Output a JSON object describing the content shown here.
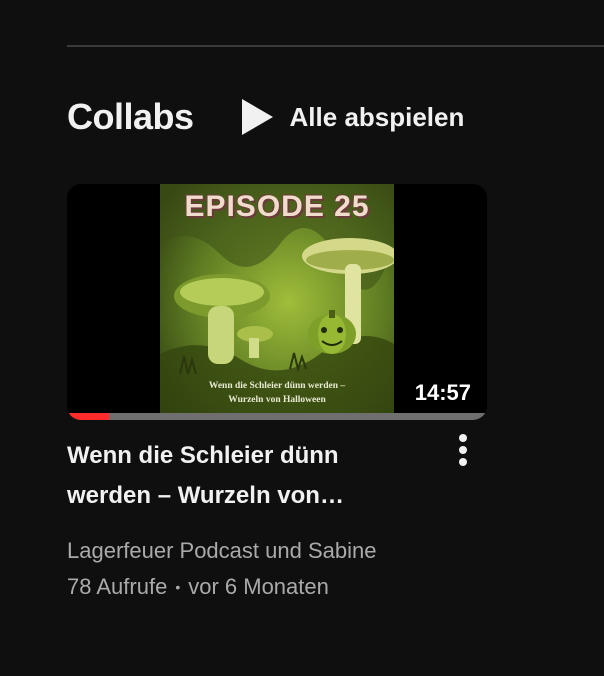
{
  "shelf": {
    "title": "Collabs",
    "play_all_label": "Alle abspielen"
  },
  "video": {
    "thumbnail": {
      "episode_text": "EPISODE 25",
      "caption_line1": "Wenn die Schleier dünn werden –",
      "caption_line2": "Wurzeln von Halloween",
      "duration": "14:57",
      "watch_progress": 0.1
    },
    "title": "Wenn die Schleier dünn werden – Wurzeln von…",
    "channel": "Lagerfeuer Podcast und Sabine",
    "views": "78 Aufrufe",
    "separator": "•",
    "age": "vor 6 Monaten"
  },
  "icons": {
    "play": "play-icon",
    "more": "more-vert-icon"
  },
  "colors": {
    "background": "#0f0f0f",
    "progress": "#ff2a2a",
    "secondary_text": "#aaaaaa"
  }
}
